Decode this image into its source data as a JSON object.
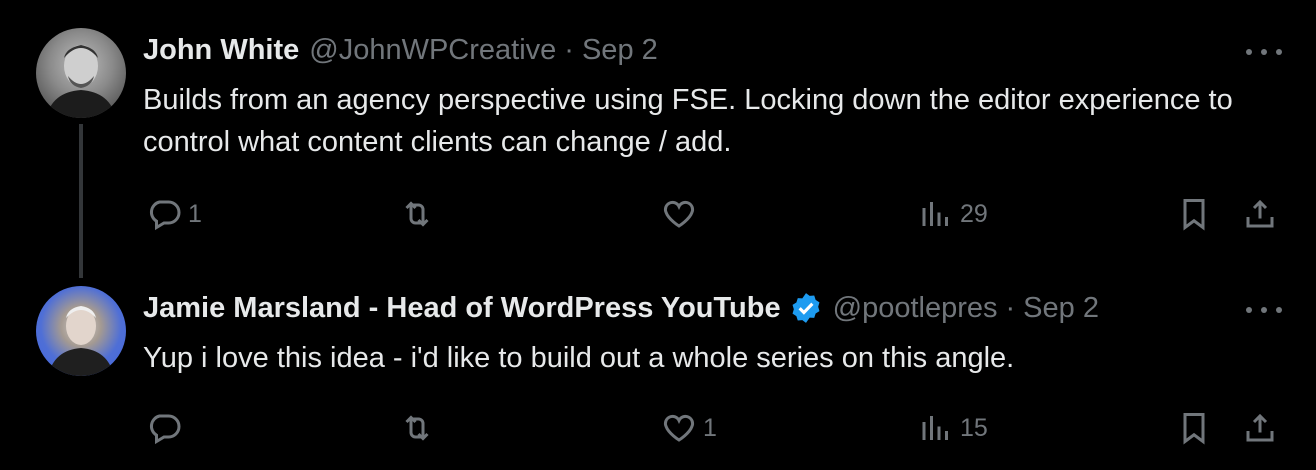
{
  "tweets": [
    {
      "author": "John White",
      "handle": "@JohnWPCreative",
      "separator": "·",
      "date": "Sep 2",
      "text": "Builds from an agency perspective using FSE. Locking down the editor experience to control what content clients can change / add.",
      "replies": "1",
      "retweets": "",
      "likes": "",
      "views": "29",
      "verified": false
    },
    {
      "author": "Jamie Marsland - Head of WordPress YouTube",
      "handle": "@pootlepres",
      "separator": "·",
      "date": "Sep 2",
      "text": "Yup i love this idea - i'd like to build out a whole series on this angle.",
      "replies": "",
      "retweets": "",
      "likes": "1",
      "views": "15",
      "verified": true
    }
  ],
  "colors": {
    "background": "#000000",
    "primary_text": "#e7e9ea",
    "secondary_text": "#71767b",
    "verified_badge": "#1d9bf0",
    "thread_line": "#333639"
  },
  "icons": [
    "reply-icon",
    "retweet-icon",
    "like-icon",
    "views-icon",
    "bookmark-icon",
    "share-icon",
    "more-icon",
    "verified-badge-icon"
  ]
}
